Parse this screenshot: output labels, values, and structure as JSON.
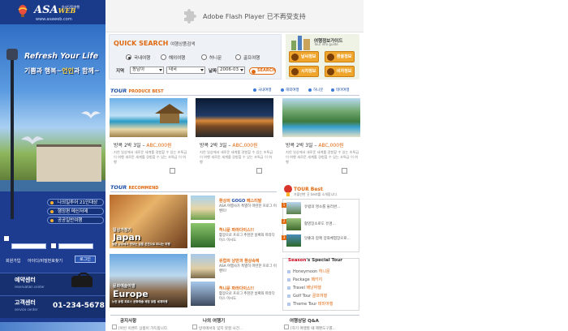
{
  "brand": {
    "logo": "ASA",
    "logo_web": "WEB",
    "logo_sub": "www.asaweb.com",
    "slogan_small": "아사닷컴여행"
  },
  "hero": {
    "title": "Refresh Your Life",
    "sub_pre": "기쁨과 행복~",
    "sub_accent": "언인",
    "sub_post": "과 함께~"
  },
  "side_menu": [
    {
      "label": "나의일투어 21인대상"
    },
    {
      "label": "행정편 메신저메"
    },
    {
      "label": "공공일반여행"
    }
  ],
  "login": {
    "signup": "회원가입",
    "find": "아이디/비밀번호찾기",
    "button": "로그인"
  },
  "contact": [
    {
      "title": "예약센터",
      "sub": "reservation center"
    },
    {
      "title": "고객센터",
      "sub": "service center",
      "number": "01-234-5678"
    }
  ],
  "flash": {
    "message": "Adobe Flash Player 已不再受支持"
  },
  "quick_search": {
    "title": "QUICK SEARCH",
    "subtitle": "여행상품검색",
    "radios": [
      {
        "label": "국내여행",
        "checked": true
      },
      {
        "label": "해외여행",
        "checked": false
      },
      {
        "label": "허니문",
        "checked": false
      },
      {
        "label": "골프여행",
        "checked": false
      }
    ],
    "region_label": "지역",
    "region_1": "동남아",
    "region_2": "태국",
    "date_label": "날짜",
    "date_value": "2006-03",
    "search_button": "SEARCH"
  },
  "guide": {
    "title": "여행정보가이드",
    "subtitle": "Tour info guide",
    "buttons": [
      "날씨정보",
      "환율정보",
      "시차정보",
      "비자정보"
    ]
  },
  "best": {
    "title": "TOUR",
    "title_sub": "PRODUCE BEST",
    "links": [
      "국내여행",
      "해외여행",
      "허니문",
      "테마여행"
    ],
    "products": [
      {
        "title": "방콕 2박 3일 – ",
        "price": "ABC,000원",
        "desc": "지친 일상에서 새로운 세계를 경험할 수 있는 초특급 이 여행 새로운 세계를 경험할 수 있는 초특급 이 여행"
      },
      {
        "title": "방콕 2박 3일 – ",
        "price": "ABC,000원",
        "desc": "지친 일상에서 새로운 세계를 경험할 수 있는 초특급 이 여행 새로운 세계를 경험할 수 있는 초특급 이 여행"
      },
      {
        "title": "방콕 2박 3일 – ",
        "price": "ABC,000원",
        "desc": "지친 일상에서 새로운 세계를 경험할 수 있는 초특급 이 여행 새로운 세계를 경험할 수 있는 초특급 이 여행"
      }
    ]
  },
  "recommend": {
    "title": "TOUR",
    "title_sub": "RECOMMEND",
    "big": [
      {
        "pre": "일상가정기",
        "name": "Japan",
        "caption": "일본 규슈에서 맛보는 일품 온천으로 떠나는 여행"
      },
      {
        "pre": "문화예술여행",
        "name": "Europe",
        "caption": "노턴 유럽 피로스 문화예술 체험 유럽 세계여행"
      }
    ],
    "items": [
      {
        "title_pre": "환상의 ",
        "title_accent": "GOGO",
        "title_post": " 페스티발",
        "text": "ASA 여행사가 특별히 마련한 프로그 이벤트!"
      },
      {
        "title_pre": "허니문 파라다이스!!",
        "title_accent": "",
        "title_post": "",
        "text": "활장으로 프로그 추천한 날짜와 파라다이스 이시도"
      },
      {
        "title_pre": "유럽의 낭만과 환상속에",
        "title_accent": "",
        "title_post": "",
        "text": "ASA 여행사가 특별히 마련한 프로그 이벤트!"
      },
      {
        "title_pre": "허니문 파라다이스!!",
        "title_accent": "",
        "title_post": "",
        "text": "활장으로 프로그 추천한 날짜와 파라다이스 이시도"
      }
    ]
  },
  "tour_best": {
    "title": "TOUR Best",
    "subtitle": "가볼만한 곳 best를 소개합니다.",
    "items": [
      {
        "num": "1",
        "text": "유럽의 명소를 둘러싼..."
      },
      {
        "num": "2",
        "text": "활영장소로도 유명..."
      },
      {
        "num": "3",
        "text": "맛좋과 함께 양화체험장으로..."
      }
    ]
  },
  "seasons": {
    "title_red": "Season",
    "title_rest": "'s Special Tour",
    "items": [
      {
        "label": "Honeymoon ",
        "accent": "허니문"
      },
      {
        "label": "Package ",
        "accent": "패키지"
      },
      {
        "label": "Travel ",
        "accent": "배낭여행"
      },
      {
        "label": "Golf Tour ",
        "accent": "골프여행"
      },
      {
        "label": "Theme Tour ",
        "accent": "테마여행"
      }
    ]
  },
  "boards": [
    {
      "title": "공지사항",
      "text": "[아빈 이벤트 상품이 가득합니다."
    },
    {
      "title": "나의 여행기",
      "text": "방콕에서의 잊지 못할 사건..."
    },
    {
      "title": "여행상담 Q&A",
      "text": "[하기 여행할 때 제편도구를..."
    }
  ],
  "colors": {
    "brand_blue": "#1d3c8f",
    "accent_orange": "#e06a12",
    "link_blue": "#1e4fa8"
  }
}
